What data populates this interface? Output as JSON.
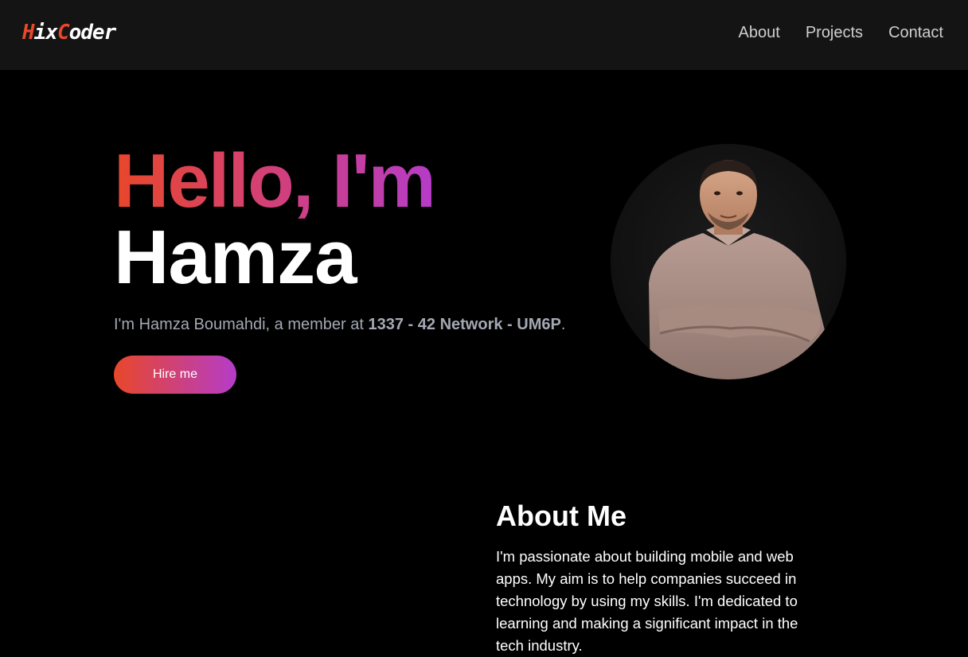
{
  "nav": {
    "logo_first": "H",
    "logo_mid": "ix",
    "logo_accent2": "C",
    "logo_rest": "oder",
    "links": [
      "About",
      "Projects",
      "Contact"
    ]
  },
  "hero": {
    "greeting": "Hello, I'm",
    "name": "Hamza",
    "subtitle_pre": "I'm Hamza Boumahdi, a member at ",
    "subtitle_bold": "1337 - 42 Network - UM6P",
    "subtitle_post": ".",
    "cta": "Hire me"
  },
  "about": {
    "title": "About Me",
    "text": "I'm passionate about building mobile and web apps. My aim is to help companies succeed in technology by using my skills. I'm dedicated to learning and making a significant impact in the tech industry."
  },
  "colors": {
    "accent_orange": "#e8472a",
    "accent_purple": "#b53cc8",
    "navbar_bg": "#141414",
    "page_bg": "#000000"
  }
}
